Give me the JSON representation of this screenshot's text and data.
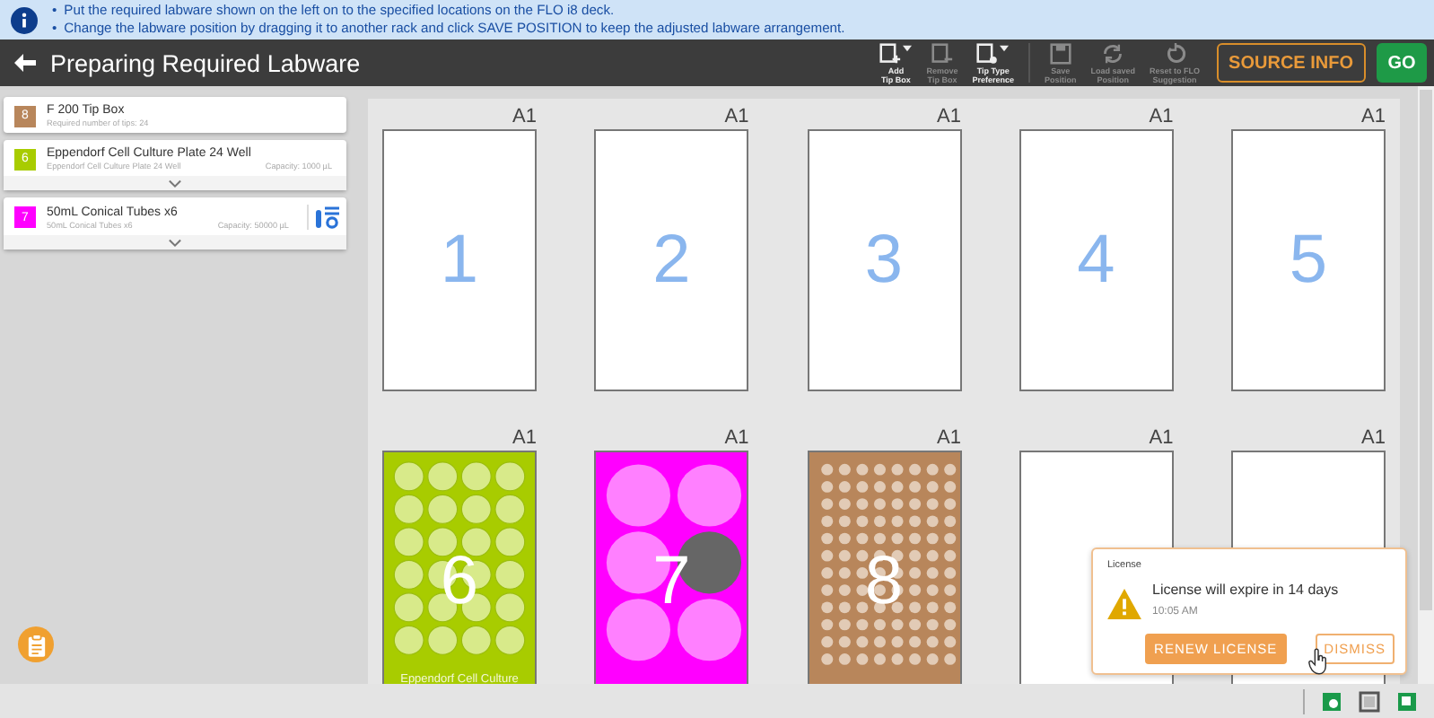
{
  "info": {
    "lines": [
      {
        "bullet": "•",
        "text": "Put the required labware shown on the left on to the specified locations on the FLO i8 deck."
      },
      {
        "bullet": "•",
        "text": "Change the labware position by dragging it to another rack and click SAVE POSITION to keep the adjusted labware arrangement."
      }
    ]
  },
  "header": {
    "title": "Preparing Required Labware"
  },
  "toolbar": [
    {
      "lines": [
        "Add",
        "Tip Box"
      ],
      "kind": "add",
      "dropdown": true,
      "disabled": false
    },
    {
      "lines": [
        "Remove",
        "Tip Box"
      ],
      "kind": "remove",
      "dropdown": false,
      "disabled": true
    },
    {
      "lines": [
        "Tip Type",
        "Preference"
      ],
      "kind": "prefs",
      "dropdown": true,
      "disabled": false
    },
    {
      "lines": [
        "Save",
        "Position"
      ],
      "kind": "save",
      "dropdown": false,
      "disabled": true
    },
    {
      "lines": [
        "Load saved",
        "Position"
      ],
      "kind": "load",
      "dropdown": false,
      "disabled": true
    },
    {
      "lines": [
        "Reset to FLO",
        "Suggestion"
      ],
      "kind": "reset",
      "dropdown": false,
      "disabled": true
    }
  ],
  "actions": {
    "source_info": "SOURCE INFO",
    "go": "GO"
  },
  "sidebar": {
    "items": [
      {
        "number": "8",
        "color": "#b8865b",
        "name": "F 200 Tip Box",
        "detail": "Required number of tips: 24",
        "expandable": false,
        "settings": false
      },
      {
        "number": "6",
        "color": "#a8cc00",
        "name": "Eppendorf Cell Culture Plate 24 Well",
        "detail": "Eppendorf Cell Culture Plate 24 Well",
        "capacity": "Capacity: 1000 µL",
        "expandable": true,
        "settings": false
      },
      {
        "number": "7",
        "color": "#ff00ff",
        "name": "50mL Conical Tubes x6",
        "detail": "50mL Conical Tubes x6",
        "capacity": "Capacity: 50000 µL",
        "expandable": true,
        "settings": true
      }
    ]
  },
  "deck": {
    "slots": [
      {
        "position": "A1",
        "number": "1",
        "kind": "empty"
      },
      {
        "position": "A1",
        "number": "2",
        "kind": "empty"
      },
      {
        "position": "A1",
        "number": "3",
        "kind": "empty"
      },
      {
        "position": "A1",
        "number": "4",
        "kind": "empty"
      },
      {
        "position": "A1",
        "number": "5",
        "kind": "empty"
      },
      {
        "position": "A1",
        "number": "6",
        "kind": "plate24",
        "color": "#a8cc00",
        "label": "Eppendorf Cell Culture"
      },
      {
        "position": "A1",
        "number": "7",
        "kind": "tubes6",
        "color": "#ff00ff",
        "tubes": [
          {
            "selected": false
          },
          {
            "selected": false
          },
          {
            "selected": false
          },
          {
            "selected": true
          },
          {
            "selected": false
          },
          {
            "selected": false
          }
        ]
      },
      {
        "position": "A1",
        "number": "8",
        "kind": "tips96",
        "color": "#b8865b"
      },
      {
        "position": "A1",
        "kind": "empty"
      },
      {
        "position": "A1",
        "kind": "empty"
      }
    ]
  },
  "notification": {
    "title": "License",
    "message": "License will expire in 14 days",
    "time": "10:05 AM",
    "buttons": [
      "RENEW LICENSE",
      "DISMISS"
    ]
  }
}
